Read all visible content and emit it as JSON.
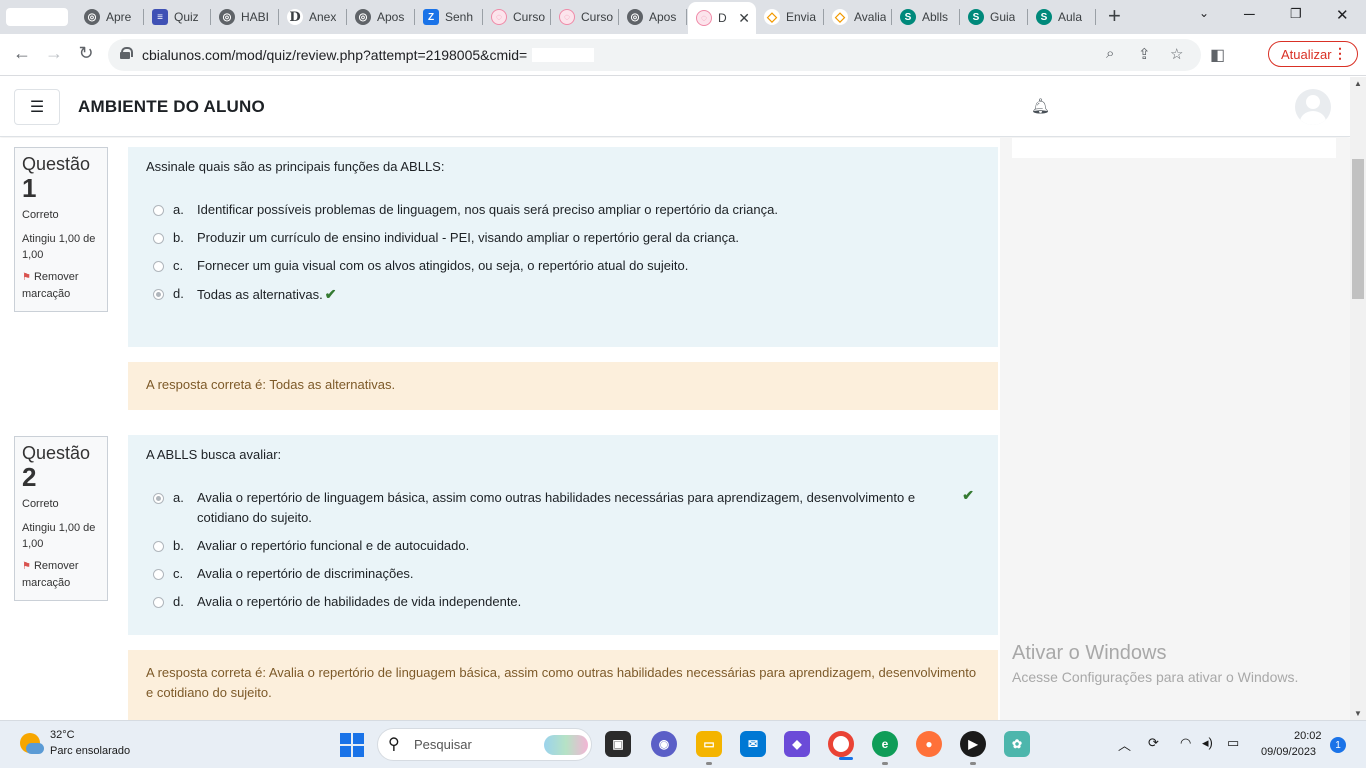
{
  "browser": {
    "tabs": [
      {
        "title": "Apre",
        "icon": "globe-icon",
        "color": "#5f6368"
      },
      {
        "title": "Quiz",
        "icon": "quiz-icon",
        "color": "#3f51b5"
      },
      {
        "title": "HABI",
        "icon": "globe-icon",
        "color": "#5f6368"
      },
      {
        "title": "Anex",
        "icon": "d-icon",
        "color": "#3c4043"
      },
      {
        "title": "Apos",
        "icon": "globe-icon",
        "color": "#5f6368"
      },
      {
        "title": "Senh",
        "icon": "z-icon",
        "color": "#1a73e8"
      },
      {
        "title": "Curso",
        "icon": "brain-icon",
        "color": "#f08aa8"
      },
      {
        "title": "Curso",
        "icon": "brain-icon",
        "color": "#f08aa8"
      },
      {
        "title": "Apos",
        "icon": "globe-icon",
        "color": "#5f6368"
      },
      {
        "title": "D",
        "icon": "brain-icon",
        "color": "#f08aa8",
        "active": true
      },
      {
        "title": "Envia",
        "icon": "hat-icon",
        "color": "#f29900"
      },
      {
        "title": "Avalia",
        "icon": "hat-icon",
        "color": "#f29900"
      },
      {
        "title": "Ablls",
        "icon": "s-icon",
        "color": "#00897b"
      },
      {
        "title": "Guia",
        "icon": "s-icon",
        "color": "#00897b"
      },
      {
        "title": "Aula",
        "icon": "s-icon",
        "color": "#00897b"
      }
    ],
    "url": "cbialunos.com/mod/quiz/review.php?attempt=2198005&cmid=",
    "update_label": "Atualizar"
  },
  "header": {
    "site_title": "AMBIENTE DO ALUNO"
  },
  "questions": [
    {
      "label": "Questão",
      "number": "1",
      "state": "Correto",
      "grade": "Atingiu 1,00 de 1,00",
      "flag": "Remover marcação",
      "text": "Assinale quais são as principais funções da ABLLS:",
      "answers": [
        {
          "letter": "a.",
          "text": "Identificar possíveis problemas de linguagem, nos quais será preciso ampliar o repertório da criança.",
          "selected": false
        },
        {
          "letter": "b.",
          "text": "Produzir um currículo de ensino individual - PEI, visando ampliar o repertório geral da criança.",
          "selected": false
        },
        {
          "letter": "c.",
          "text": "Fornecer um guia visual com os alvos atingidos, ou seja, o repertório atual do sujeito.",
          "selected": false
        },
        {
          "letter": "d.",
          "text": "Todas as alternativas.",
          "selected": true
        }
      ],
      "feedback": "A resposta correta é: Todas as alternativas."
    },
    {
      "label": "Questão",
      "number": "2",
      "state": "Correto",
      "grade": "Atingiu 1,00 de 1,00",
      "flag": "Remover marcação",
      "text": "A ABLLS busca avaliar:",
      "answers": [
        {
          "letter": "a.",
          "text": "Avalia o repertório de linguagem básica, assim como outras habilidades necessárias para aprendizagem, desenvolvimento e cotidiano do sujeito.",
          "selected": true
        },
        {
          "letter": "b.",
          "text": "Avaliar o repertório funcional e de autocuidado.",
          "selected": false
        },
        {
          "letter": "c.",
          "text": "Avalia o repertório de discriminações.",
          "selected": false
        },
        {
          "letter": "d.",
          "text": "Avalia o repertório de habilidades de vida independente.",
          "selected": false
        }
      ],
      "feedback": "A resposta correta é: Avalia o repertório de linguagem básica, assim como outras habilidades necessárias para aprendizagem, desenvolvimento e cotidiano do sujeito."
    }
  ],
  "watermark": {
    "title": "Ativar o Windows",
    "subtitle": "Acesse Configurações para ativar o Windows."
  },
  "taskbar": {
    "temperature": "32°C",
    "weather": "Parc ensolarado",
    "search_placeholder": "Pesquisar",
    "time": "20:02",
    "date": "09/09/2023",
    "notifications": "1"
  },
  "colors": {
    "question_bg": "#eaf4f8",
    "feedback_bg": "#fcefdc",
    "feedback_text": "#7d5a29",
    "correct_check": "#357a32",
    "flag": "#d9534f",
    "update_button": "#d93025"
  }
}
